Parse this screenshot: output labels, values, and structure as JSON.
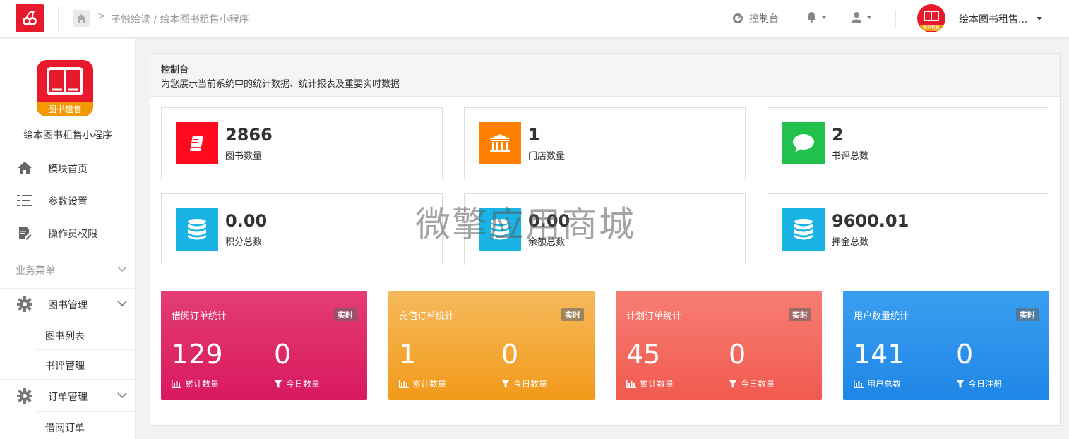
{
  "header": {
    "breadcrumb": "子悦绘读 / 绘本图书租售小程序",
    "console_label": "控制台",
    "account_name": "绘本图书租售...",
    "avatar_tag": "图书租售"
  },
  "sidebar": {
    "app_name": "绘本图书租售小程序",
    "logo_tag": "图书租售",
    "items": [
      {
        "label": "模块首页",
        "icon": "home-icon"
      },
      {
        "label": "参数设置",
        "icon": "list-icon"
      },
      {
        "label": "操作员权限",
        "icon": "edit-doc-icon"
      }
    ],
    "group_label": "业务菜单",
    "book_mgmt": "图书管理",
    "book_list": "图书列表",
    "review_mgmt": "书评管理",
    "order_mgmt": "订单管理",
    "borrow_orders": "借阅订单"
  },
  "panel": {
    "title": "控制台",
    "subtitle": "为您展示当前系统中的统计数据、统计报表及重要实时数据"
  },
  "stats": [
    {
      "value": "2866",
      "label": "图书数量",
      "color": "#ff0a1f",
      "icon": "book-icon"
    },
    {
      "value": "1",
      "label": "门店数量",
      "color": "#ff7f00",
      "icon": "bank-icon"
    },
    {
      "value": "2",
      "label": "书评总数",
      "color": "#22c04d",
      "icon": "chat-icon"
    },
    {
      "value": "0.00",
      "label": "积分总数",
      "color": "#1ab3e6",
      "icon": "database-icon"
    },
    {
      "value": "0.00",
      "label": "余额总数",
      "color": "#1ab3e6",
      "icon": "database-icon"
    },
    {
      "value": "9600.01",
      "label": "押金总数",
      "color": "#1ab3e6",
      "icon": "database-icon"
    }
  ],
  "cards": [
    {
      "title": "借阅订单统计",
      "badge": "实时",
      "v1": "129",
      "l1": "累计数量",
      "v2": "0",
      "l2": "今日数量"
    },
    {
      "title": "充值订单统计",
      "badge": "实时",
      "v1": "1",
      "l1": "累计数量",
      "v2": "0",
      "l2": "今日数量"
    },
    {
      "title": "计划订单统计",
      "badge": "实时",
      "v1": "45",
      "l1": "累计数量",
      "v2": "0",
      "l2": "今日数量"
    },
    {
      "title": "用户数量统计",
      "badge": "实时",
      "v1": "141",
      "l1": "用户总数",
      "v2": "0",
      "l2": "今日注册"
    }
  ],
  "watermark": "微擎应用商城"
}
